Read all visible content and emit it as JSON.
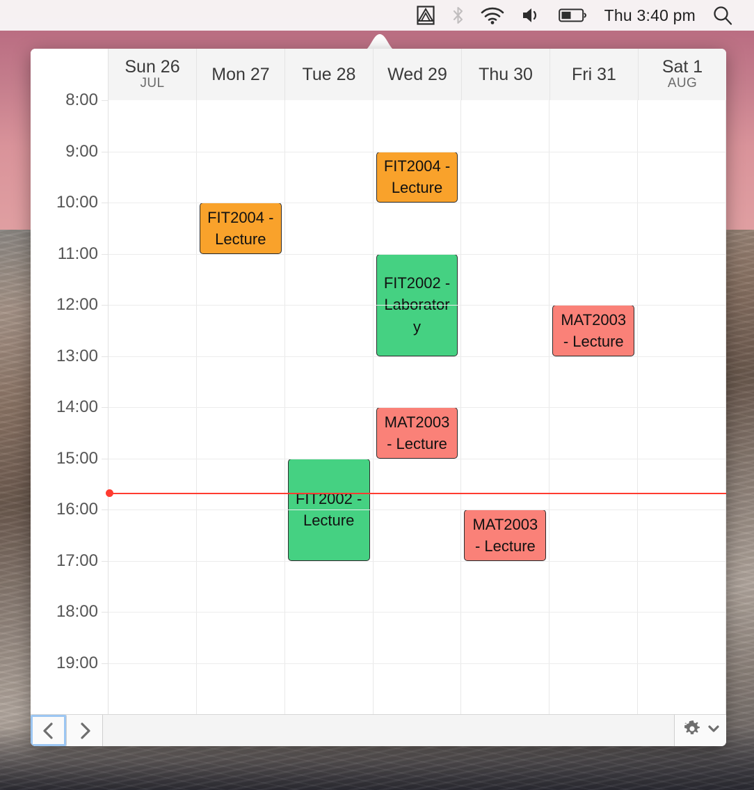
{
  "menubar": {
    "app_icon": "mountain-app-icon",
    "bluetooth_icon": "bluetooth-icon",
    "wifi_icon": "wifi-icon",
    "volume_icon": "volume-icon",
    "battery_icon": "battery-icon",
    "clock": "Thu 3:40 pm",
    "search_icon": "spotlight-search-icon"
  },
  "calendar": {
    "days": [
      {
        "name": "Sun 26",
        "month": "JUL"
      },
      {
        "name": "Mon 27",
        "month": ""
      },
      {
        "name": "Tue 28",
        "month": ""
      },
      {
        "name": "Wed 29",
        "month": ""
      },
      {
        "name": "Thu 30",
        "month": ""
      },
      {
        "name": "Fri 31",
        "month": ""
      },
      {
        "name": "Sat 1",
        "month": "AUG"
      }
    ],
    "hours": [
      "8:00",
      "9:00",
      "10:00",
      "11:00",
      "12:00",
      "13:00",
      "14:00",
      "15:00",
      "16:00",
      "17:00",
      "18:00",
      "19:00"
    ],
    "hour_start": 8,
    "hour_end": 20,
    "now_time": "15:40",
    "now_color": "#ff3b30",
    "colors": {
      "orange": "#F9A22B",
      "green": "#45D182",
      "red": "#FA8178"
    },
    "events": [
      {
        "title": "FIT2004 - Lecture",
        "day": 1,
        "start": "10:00",
        "end": "11:00",
        "color": "#F9A22B"
      },
      {
        "title": "FIT2004 - Lecture",
        "day": 3,
        "start": "9:00",
        "end": "10:00",
        "color": "#F9A22B"
      },
      {
        "title": "FIT2002 - Laboratory",
        "day": 3,
        "start": "11:00",
        "end": "13:00",
        "color": "#45D182"
      },
      {
        "title": "MAT2003 - Lecture",
        "day": 5,
        "start": "12:00",
        "end": "13:00",
        "color": "#FA8178"
      },
      {
        "title": "MAT2003 - Lecture",
        "day": 3,
        "start": "14:00",
        "end": "15:00",
        "color": "#FA8178"
      },
      {
        "title": "FIT2002 - Lecture",
        "day": 2,
        "start": "15:00",
        "end": "17:00",
        "color": "#45D182"
      },
      {
        "title": "MAT2003 - Lecture",
        "day": 4,
        "start": "16:00",
        "end": "17:00",
        "color": "#FA8178"
      }
    ]
  },
  "toolbar": {
    "prev_icon": "chevron-left-icon",
    "next_icon": "chevron-right-icon",
    "gear_icon": "gear-icon",
    "gear_chevron_icon": "chevron-down-icon"
  }
}
